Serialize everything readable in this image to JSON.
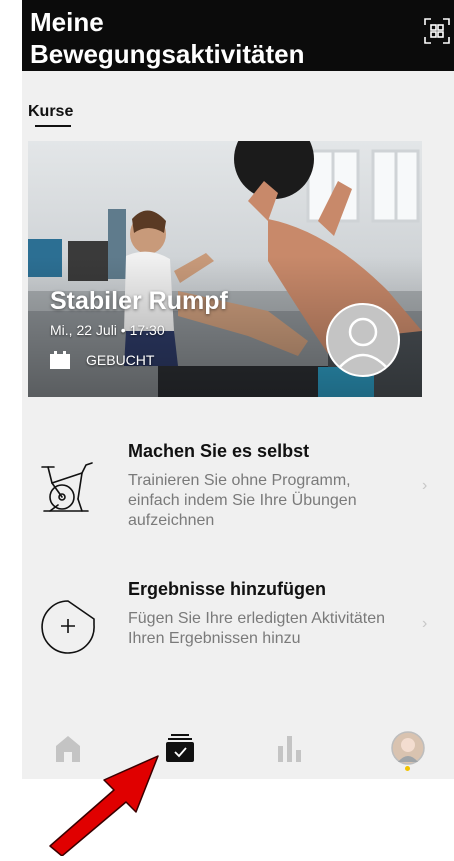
{
  "header": {
    "title_line1": "Meine",
    "title_line2": "Bewegungsaktivitäten",
    "qr_icon": "qr-scan-icon"
  },
  "tabs": {
    "active": "Kurse"
  },
  "course": {
    "title": "Stabiler Rumpf",
    "datetime": "Mi., 22 Juli • 17:30",
    "status": "GEBUCHT"
  },
  "actions": [
    {
      "title": "Machen Sie es selbst",
      "description": "Trainieren Sie ohne Programm, einfach indem Sie Ihre Übungen aufzeichnen",
      "icon": "exercise-bike-icon"
    },
    {
      "title": "Ergebnisse hinzufügen",
      "description": "Fügen Sie Ihre erledigten Aktivitäten Ihren Ergebnissen hinzu",
      "icon": "add-circle-icon"
    }
  ],
  "nav": {
    "items": [
      "home-icon",
      "activities-icon",
      "stats-icon",
      "profile-avatar"
    ],
    "active": "activities-icon"
  },
  "colors": {
    "header_bg": "#0b0b0b",
    "panel_bg": "#f0f0f0",
    "arrow": "#e00000",
    "indicator": "#f2c300"
  }
}
